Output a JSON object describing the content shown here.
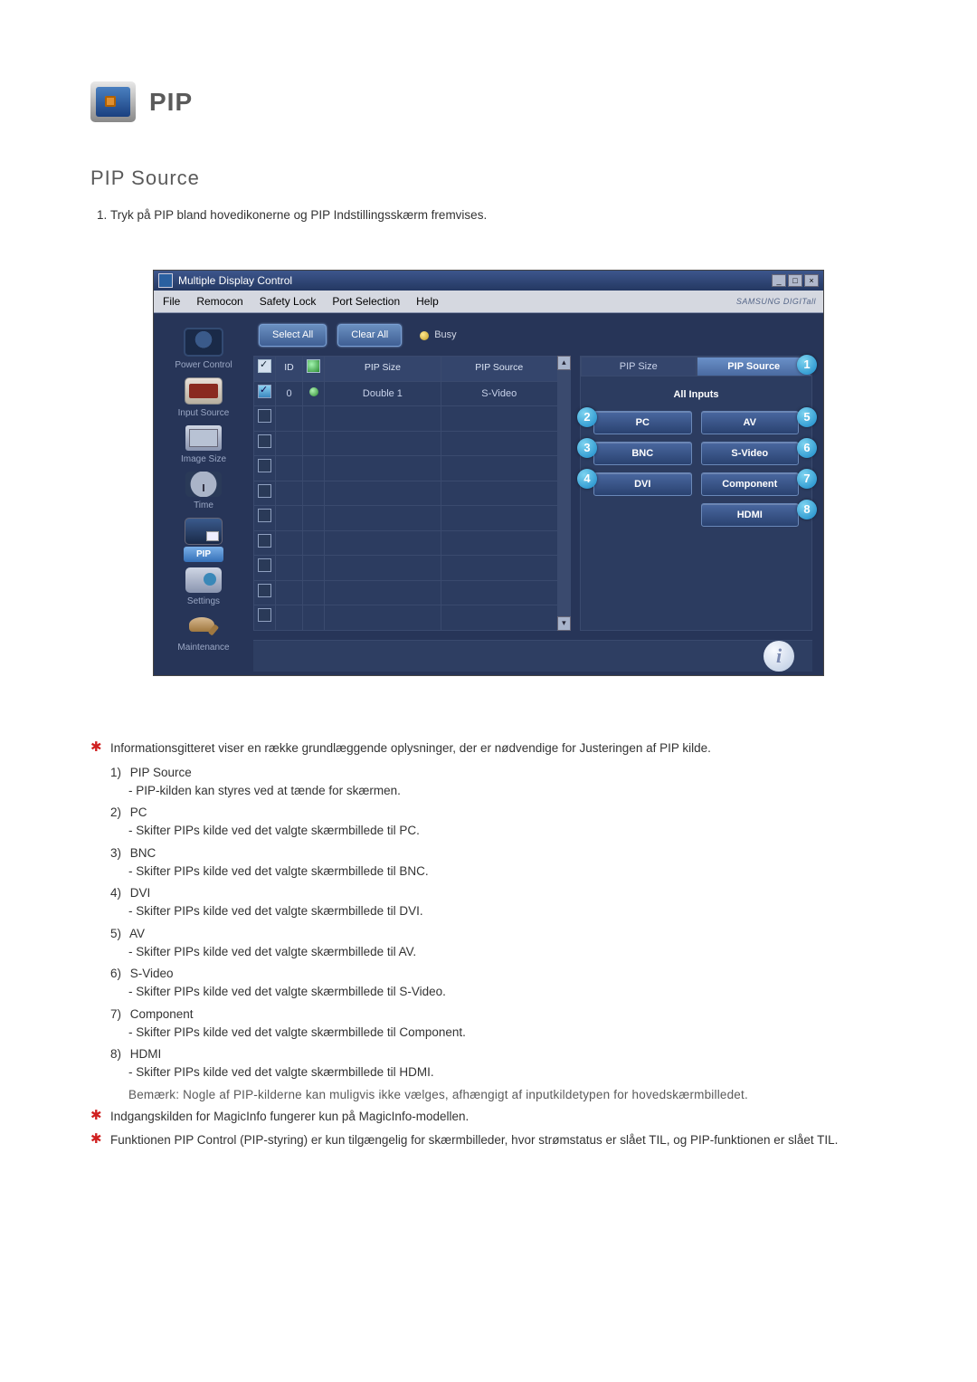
{
  "header": {
    "icon_label": "PIP",
    "title": "PIP"
  },
  "section": {
    "title": "PIP Source"
  },
  "intro": {
    "item1": "Tryk på PIP bland hovedikonerne og PIP Indstillingsskærm fremvises."
  },
  "window": {
    "title": "Multiple Display Control",
    "menu": {
      "file": "File",
      "remocon": "Remocon",
      "safety": "Safety Lock",
      "port": "Port Selection",
      "help": "Help"
    },
    "brand": "SAMSUNG DIGITall",
    "toolbar": {
      "select_all": "Select All",
      "clear_all": "Clear All",
      "busy": "Busy"
    },
    "sidebar": {
      "power": "Power Control",
      "input": "Input Source",
      "image": "Image Size",
      "time": "Time",
      "pip": "PIP",
      "settings": "Settings",
      "maintenance": "Maintenance"
    },
    "grid": {
      "headers": {
        "id": "ID",
        "pip_size": "PIP Size",
        "pip_source": "PIP Source"
      },
      "row": {
        "id": "0",
        "size": "Double 1",
        "source": "S-Video"
      }
    },
    "right": {
      "tab_size": "PIP Size",
      "tab_source": "PIP Source",
      "all_inputs": "All Inputs",
      "pc": "PC",
      "av": "AV",
      "bnc": "BNC",
      "svideo": "S-Video",
      "dvi": "DVI",
      "component": "Component",
      "hdmi": "HDMI"
    },
    "callouts": {
      "c1": "1",
      "c2": "2",
      "c3": "3",
      "c4": "4",
      "c5": "5",
      "c6": "6",
      "c7": "7",
      "c8": "8"
    }
  },
  "notes": {
    "star1": "Informationsgitteret viser en række grundlæggende oplysninger, der er nødvendige for Justeringen af PIP kilde.",
    "star2": "Indgangskilden for MagicInfo fungerer kun på MagicInfo-modellen.",
    "star3": "Funktionen PIP Control (PIP-styring) er kun tilgængelig for skærmbilleder, hvor strømstatus er slået TIL, og PIP-funktionen er slået TIL."
  },
  "list": {
    "i1": {
      "n": "1)",
      "t": "PIP Source",
      "d": "- PIP-kilden kan styres ved at tænde for skærmen."
    },
    "i2": {
      "n": "2)",
      "t": "PC",
      "d": "- Skifter PIPs kilde ved det valgte skærmbillede til PC."
    },
    "i3": {
      "n": "3)",
      "t": "BNC",
      "d": "- Skifter PIPs kilde ved det valgte skærmbillede til BNC."
    },
    "i4": {
      "n": "4)",
      "t": "DVI",
      "d": "- Skifter PIPs kilde ved det valgte skærmbillede til DVI."
    },
    "i5": {
      "n": "5)",
      "t": "AV",
      "d": "- Skifter PIPs kilde ved det valgte skærmbillede til AV."
    },
    "i6": {
      "n": "6)",
      "t": "S-Video",
      "d": "- Skifter PIPs kilde ved det valgte skærmbillede til S-Video."
    },
    "i7": {
      "n": "7)",
      "t": "Component",
      "d": "- Skifter PIPs kilde ved det valgte skærmbillede til Component."
    },
    "i8": {
      "n": "8)",
      "t": "HDMI",
      "d": "- Skifter PIPs kilde ved det valgte skærmbillede til HDMI.",
      "note": "Bemærk: Nogle af PIP-kilderne kan muligvis ikke vælges, afhængigt af inputkildetypen for hovedskærmbilledet."
    }
  }
}
